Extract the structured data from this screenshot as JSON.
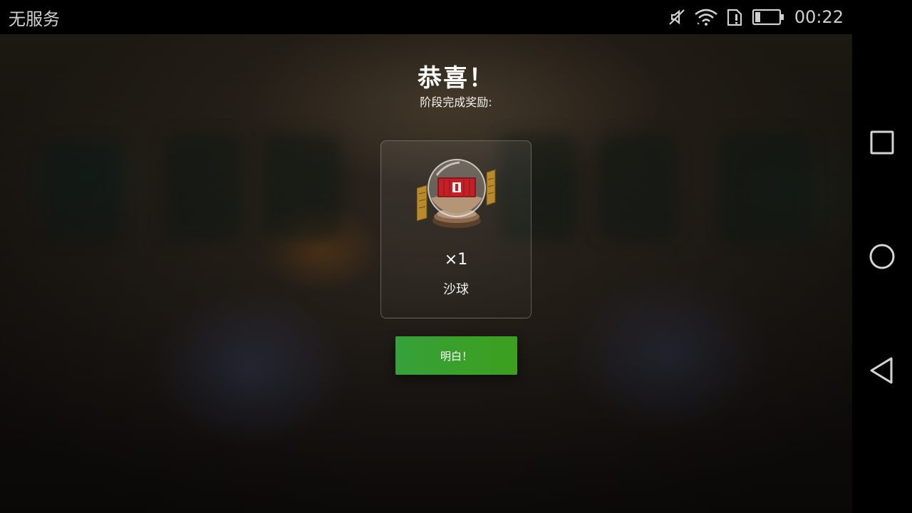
{
  "status_bar": {
    "carrier": "无服务",
    "time": "00:22",
    "icons": [
      "mute-icon",
      "wifi-icon",
      "sim-alert-icon",
      "battery-icon"
    ]
  },
  "nav_bar": {
    "icons": [
      "recent-apps-icon",
      "home-icon",
      "back-icon"
    ]
  },
  "dialog": {
    "title": "恭喜！",
    "subtitle": "阶段完成奖励:",
    "reward": {
      "icon": "snow-globe-container-icon",
      "quantity": "×1",
      "name": "沙球"
    },
    "button_label": "明白！"
  },
  "colors": {
    "button_green": "#3d9f2a",
    "status_text": "#cfcfcf"
  }
}
